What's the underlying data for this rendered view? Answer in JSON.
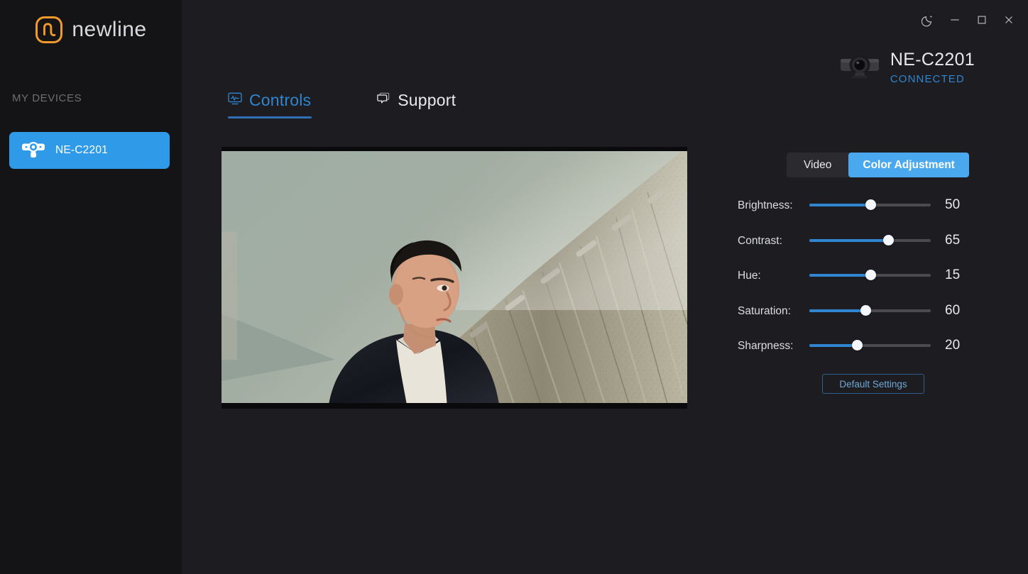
{
  "app": {
    "brand": "newline",
    "background": "#1d1d21",
    "sidebar_background": "#141416",
    "accent": "#2f85d0",
    "toggle_active": "#4aa8ef",
    "brand_orange": "#F09A2B"
  },
  "window_controls": [
    {
      "name": "night-mode-icon",
      "label": "Night mode"
    },
    {
      "name": "minimize-button",
      "label": "Minimize"
    },
    {
      "name": "maximize-button",
      "label": "Maximize"
    },
    {
      "name": "close-button",
      "label": "Close"
    }
  ],
  "sidebar": {
    "section_title": "MY DEVICES",
    "devices": [
      {
        "label": "NE-C2201",
        "icon": "webcam-icon",
        "selected": true
      }
    ]
  },
  "device_header": {
    "icon": "webcam-icon",
    "name": "NE-C2201",
    "status": "CONNECTED"
  },
  "tabs": [
    {
      "label": "Controls",
      "icon": "monitor-waveform-icon",
      "active": true
    },
    {
      "label": "Support",
      "icon": "chat-bubble-icon",
      "active": false
    }
  ],
  "video_preview": {
    "alt": "Live camera preview of a person seated in front of patterned curtains"
  },
  "mode_toggle": {
    "options": [
      {
        "label": "Video",
        "active": false
      },
      {
        "label": "Color Adjustment",
        "active": true
      }
    ]
  },
  "color_adjustment": {
    "sliders": [
      {
        "label": "Brightness:",
        "value": 50,
        "percent": 50
      },
      {
        "label": "Contrast:",
        "value": 65,
        "percent": 65
      },
      {
        "label": "Hue:",
        "value": 15,
        "percent": 50
      },
      {
        "label": "Saturation:",
        "value": 60,
        "percent": 46
      },
      {
        "label": "Sharpness:",
        "value": 20,
        "percent": 39
      }
    ],
    "default_button": "Default Settings"
  }
}
